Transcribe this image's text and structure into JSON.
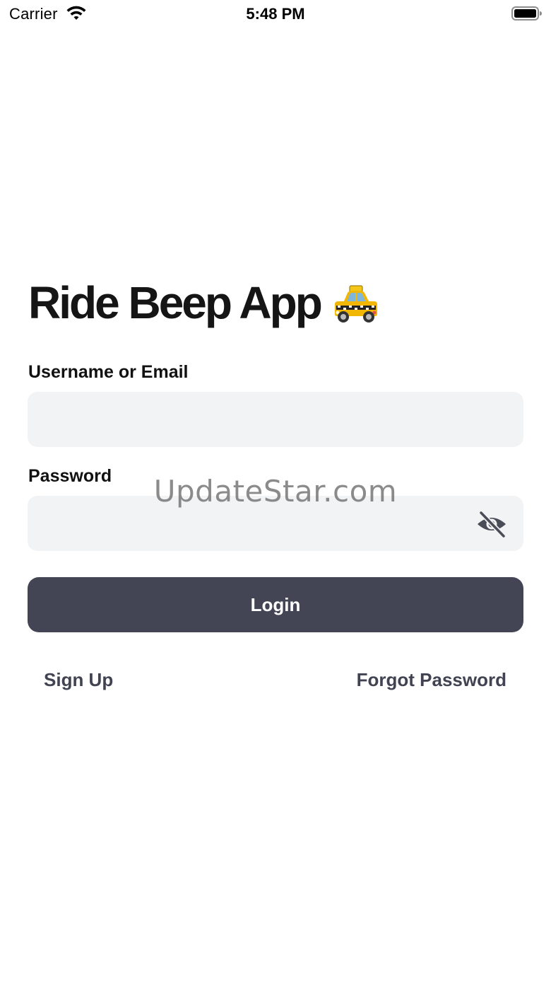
{
  "status_bar": {
    "carrier": "Carrier",
    "time": "5:48 PM",
    "wifi_icon": "wifi-icon",
    "battery_icon": "battery-icon"
  },
  "app": {
    "title": "Ride Beep App",
    "title_icon": "taxi-icon"
  },
  "form": {
    "username_label": "Username or Email",
    "username_value": "",
    "password_label": "Password",
    "password_value": "",
    "password_toggle_icon": "eye-slash-icon",
    "login_label": "Login"
  },
  "links": {
    "signup": "Sign Up",
    "forgot_password": "Forgot Password"
  },
  "watermark": "UpdateStar.com",
  "colors": {
    "button_bg": "#434555",
    "input_bg": "#f2f3f4",
    "link_text": "#414352"
  }
}
